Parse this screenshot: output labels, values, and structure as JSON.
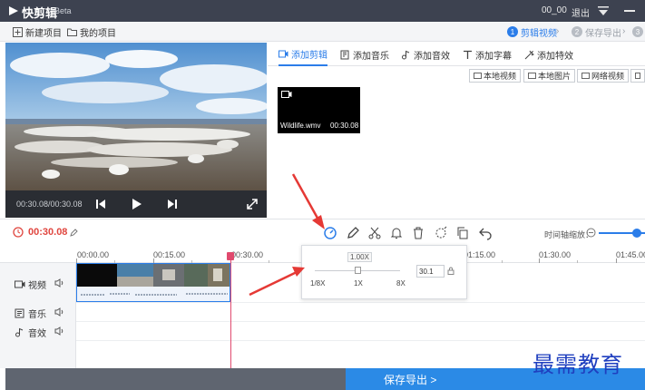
{
  "colors": {
    "accent": "#2b7de9",
    "time": "#e0463f",
    "playhead": "#e04a6e",
    "annotation": "#e53935",
    "watermark": "#1f3fbf"
  },
  "titlebar": {
    "app_name": "快剪辑",
    "beta": "Beta",
    "user": "00_00",
    "logout": "退出"
  },
  "toolbar": {
    "new_project": "新建项目",
    "my_projects": "我的项目",
    "steps": [
      {
        "num": "1",
        "label": "剪辑视频",
        "active": true
      },
      {
        "num": "2",
        "label": "保存导出",
        "active": false
      },
      {
        "num": "3",
        "label": "",
        "active": false
      }
    ]
  },
  "player": {
    "time": "00:30.08/00:30.08"
  },
  "media": {
    "tabs": [
      {
        "label": "添加剪辑",
        "icon": "video-icon",
        "active": true
      },
      {
        "label": "添加音乐",
        "icon": "music-icon",
        "active": false
      },
      {
        "label": "添加音效",
        "icon": "sound-effect-icon",
        "active": false
      },
      {
        "label": "添加字幕",
        "icon": "text-icon",
        "active": false
      },
      {
        "label": "添加特效",
        "icon": "effect-icon",
        "active": false
      }
    ],
    "buttons": [
      "本地视频",
      "本地图片",
      "网络视频"
    ],
    "clip": {
      "name": "Wildlife.wmv",
      "duration": "00:30.08"
    }
  },
  "timeline": {
    "current_time": "00:30.08",
    "zoom_label": "时间轴缩放：",
    "tools": [
      "speed-icon",
      "pencil-icon",
      "scissors-icon",
      "bell-icon",
      "trash-icon",
      "crop-icon",
      "copy-icon",
      "undo-icon"
    ],
    "ruler": [
      "00:00.00",
      "00:15.00",
      "00:30.00",
      "01:15.00",
      "01:30.00",
      "01:45.00"
    ],
    "tracks": [
      {
        "label": "视频",
        "icon": "video-track-icon"
      },
      {
        "label": "音乐",
        "icon": "music-track-icon"
      },
      {
        "label": "音效",
        "icon": "sound-track-icon"
      }
    ]
  },
  "speed_popup": {
    "current": "1.00X",
    "min_label": "1/8X",
    "mid_label": "1X",
    "max_label": "8X",
    "input_value": "30.1"
  },
  "export": {
    "label": "保存导出 >"
  },
  "watermark": "最需教育"
}
